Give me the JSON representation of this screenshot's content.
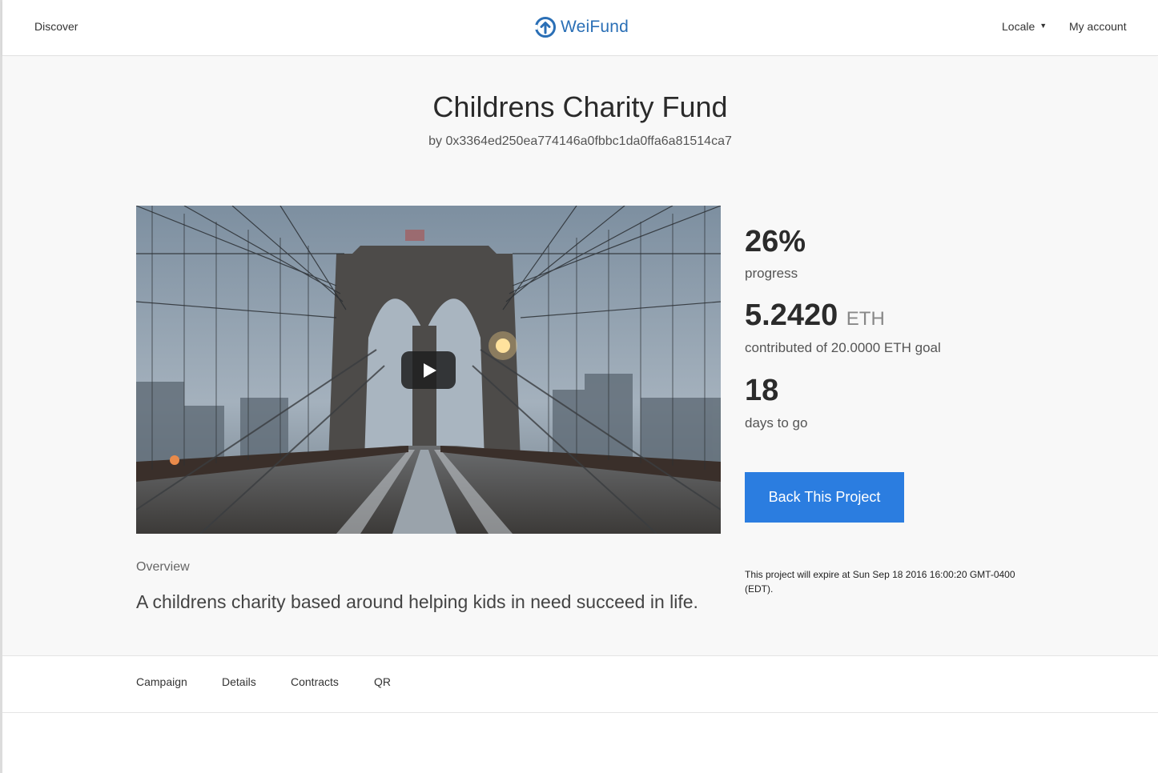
{
  "header": {
    "discover_label": "Discover",
    "logo_text": "WeiFund",
    "locale_label": "Locale",
    "account_label": "My account"
  },
  "project": {
    "title": "Childrens Charity Fund",
    "byline": "by 0x3364ed250ea774146a0fbbc1da0ffa6a81514ca7",
    "progress_value": "26%",
    "progress_label": "progress",
    "contributed_value": "5.2420",
    "contributed_unit": "ETH",
    "contributed_label": "contributed of 20.0000 ETH goal",
    "days_value": "18",
    "days_label": "days to go",
    "back_button_label": "Back This Project",
    "expire_text": "This project will expire at Sun Sep 18 2016 16:00:20 GMT-0400 (EDT).",
    "overview_label": "Overview",
    "overview_text": "A childrens charity based around helping kids in need succeed in life."
  },
  "tabs": [
    "Campaign",
    "Details",
    "Contracts",
    "QR"
  ],
  "colors": {
    "accent": "#2b7de0",
    "logo": "#2a6fb6",
    "page_background": "#f8f8f8"
  },
  "icons": {
    "logo": "upload-arrow-circle-icon",
    "video_play": "play-icon",
    "locale_dropdown": "caret-down-icon"
  }
}
